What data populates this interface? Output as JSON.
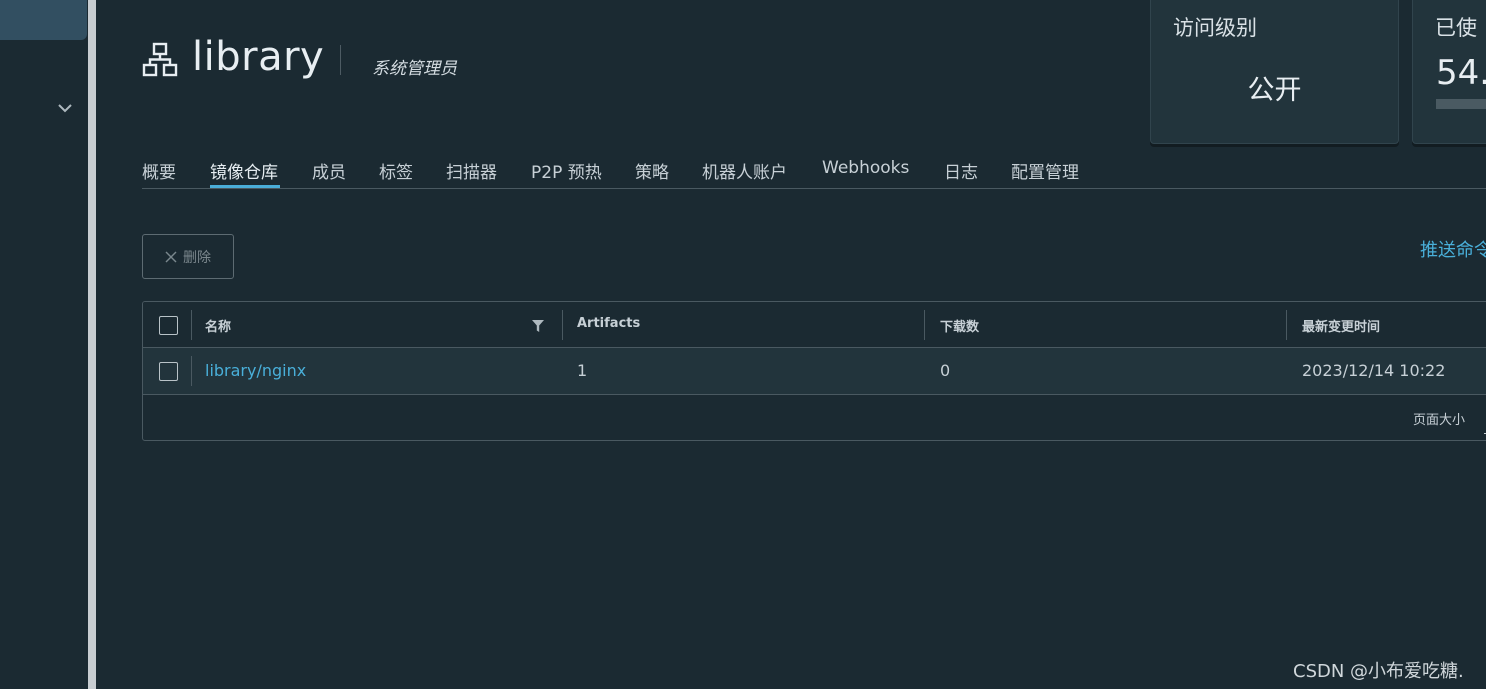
{
  "project": {
    "name": "library",
    "role": "系统管理员"
  },
  "cards": {
    "access": {
      "label": "访问级别",
      "value": "公开"
    },
    "quota": {
      "label": "已使",
      "value": "54."
    }
  },
  "tabs": [
    {
      "label": "概要",
      "active": false
    },
    {
      "label": "镜像仓库",
      "active": true
    },
    {
      "label": "成员",
      "active": false
    },
    {
      "label": "标签",
      "active": false
    },
    {
      "label": "扫描器",
      "active": false
    },
    {
      "label": "P2P 预热",
      "active": false
    },
    {
      "label": "策略",
      "active": false
    },
    {
      "label": "机器人账户",
      "active": false
    },
    {
      "label": "Webhooks",
      "active": false
    },
    {
      "label": "日志",
      "active": false
    },
    {
      "label": "配置管理",
      "active": false
    }
  ],
  "toolbar": {
    "delete_label": "删除",
    "push_command": "推送命令"
  },
  "table": {
    "columns": [
      "名称",
      "Artifacts",
      "下载数",
      "最新变更时间"
    ],
    "rows": [
      {
        "name": "library/nginx",
        "artifacts": "1",
        "downloads": "0",
        "updated": "2023/12/14 10:22"
      }
    ],
    "footer": {
      "page_size_label": "页面大小"
    }
  },
  "watermark": "CSDN @小布爱吃糖.",
  "colors": {
    "background": "#1b2a32",
    "accent": "#49afd9",
    "card": "#22343c"
  }
}
